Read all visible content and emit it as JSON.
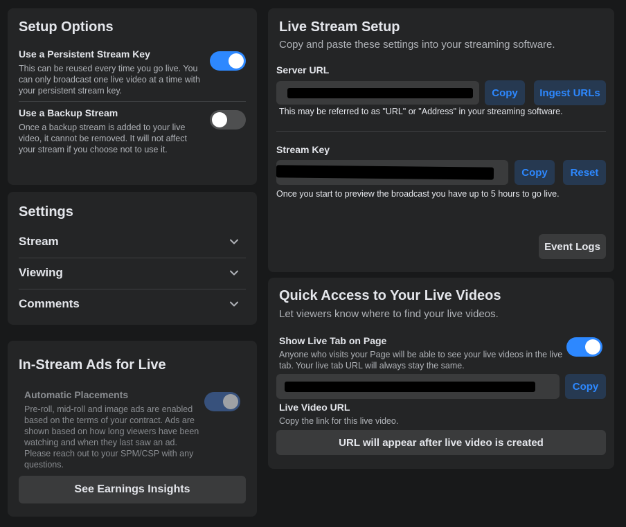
{
  "setup_options": {
    "title": "Setup Options",
    "persistent_key": {
      "label": "Use a Persistent Stream Key",
      "desc": "This can be reused every time you go live. You can only broadcast one live video at a time with your persistent stream key.",
      "on": true
    },
    "backup_stream": {
      "label": "Use a Backup Stream",
      "desc": "Once a backup stream is added to your live video, it cannot be removed. It will not affect your stream if you choose not to use it.",
      "on": false
    }
  },
  "settings": {
    "title": "Settings",
    "items": [
      {
        "label": "Stream"
      },
      {
        "label": "Viewing"
      },
      {
        "label": "Comments"
      }
    ]
  },
  "ads": {
    "title": "In-Stream Ads for Live",
    "placements_label": "Automatic Placements",
    "placements_desc": "Pre-roll, mid-roll and image ads are enabled based on the terms of your contract. Ads are shown based on how long viewers have been watching and when they last saw an ad. Please reach out to your SPM/CSP with any questions.",
    "earnings_button": "See Earnings Insights"
  },
  "live_setup": {
    "title": "Live Stream Setup",
    "subtitle": "Copy and paste these settings into your streaming software.",
    "server_url_label": "Server URL",
    "copy_label": "Copy",
    "ingest_label": "Ingest URLs",
    "server_url_hint": "This may be referred to as \"URL\" or \"Address\" in your streaming software.",
    "stream_key_label": "Stream Key",
    "reset_label": "Reset",
    "stream_key_hint": "Once you start to preview the broadcast you have up to 5 hours to go live.",
    "event_logs_label": "Event Logs"
  },
  "quick_access": {
    "title": "Quick Access to Your Live Videos",
    "subtitle": "Let viewers know where to find your live videos.",
    "live_tab_label": "Show Live Tab on Page",
    "live_tab_desc": "Anyone who visits your Page will be able to see your live videos in the live tab. Your live tab URL will always stay the same.",
    "live_tab_on": true,
    "copy_label": "Copy",
    "live_video_url_label": "Live Video URL",
    "live_video_url_desc": "Copy the link for this live video.",
    "url_placeholder": "URL will appear after live video is created"
  },
  "colors": {
    "background": "#18191a",
    "card": "#242526",
    "accent": "#2d88ff",
    "button_blue_bg": "#263951",
    "button_gray_bg": "#3a3b3c"
  }
}
